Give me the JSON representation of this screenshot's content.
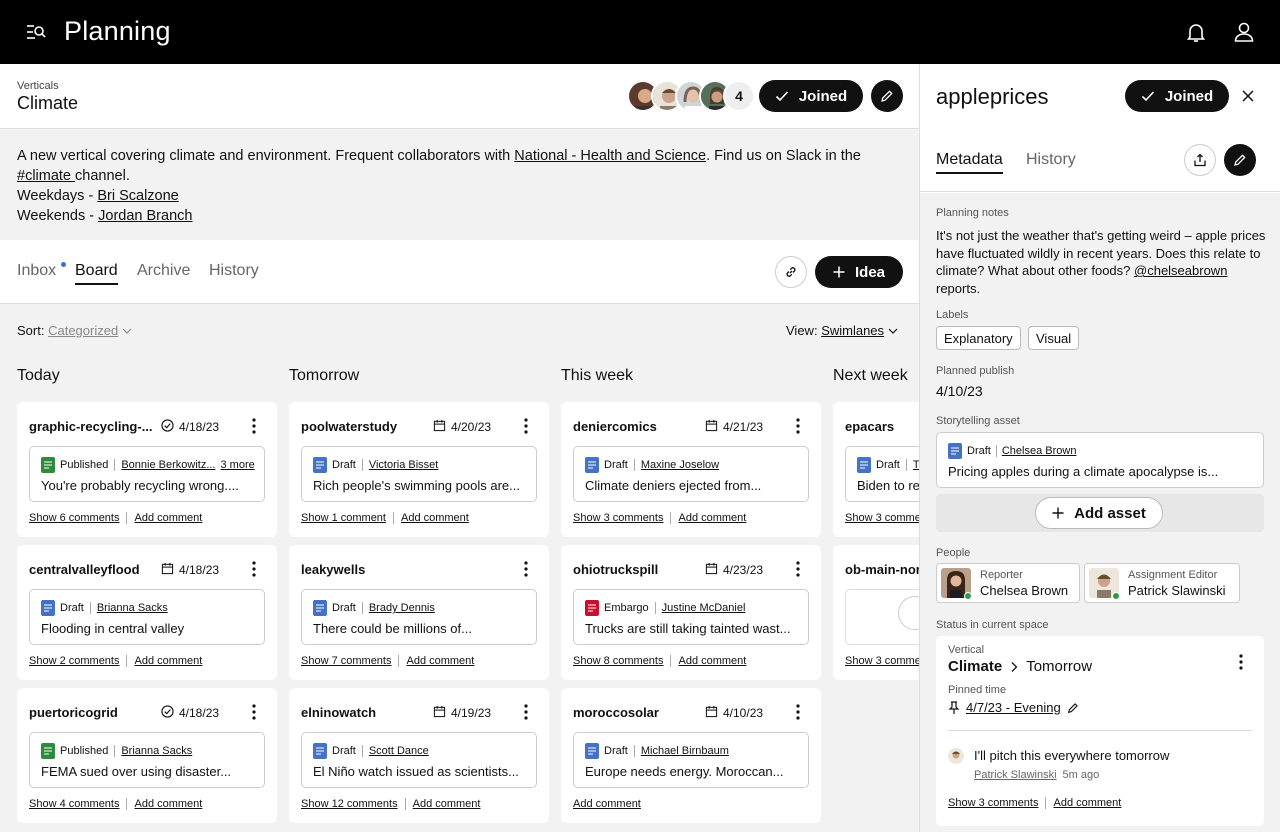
{
  "app": {
    "title": "Planning"
  },
  "vertical": {
    "kicker": "Verticals",
    "title": "Climate",
    "member_count": "4",
    "joined_label": "Joined",
    "desc_prefix": "A new vertical covering climate and environment. Frequent collaborators with ",
    "desc_link": "National - Health and Science",
    "desc_mid": ". Find us on Slack in the ",
    "desc_channel": "#climate ",
    "desc_suffix": "channel.",
    "weekdays_label": "Weekdays - ",
    "weekdays_name": "Bri Scalzone",
    "weekends_label": "Weekends - ",
    "weekends_name": "Jordan Branch"
  },
  "tabs": [
    "Inbox",
    "Board",
    "Archive",
    "History"
  ],
  "active_tab": "Board",
  "idea_label": "Idea",
  "sort": {
    "label": "Sort:",
    "value": "Categorized"
  },
  "view": {
    "label": "View:",
    "value": "Swimlanes"
  },
  "columns": [
    "Today",
    "Tomorrow",
    "This week",
    "Next week"
  ],
  "cards": [
    [
      {
        "slug": "graphic-recycling-...",
        "date": "4/18/23",
        "date_icon": "check-circle",
        "status": "Published",
        "author": "Bonnie Berkowitz...",
        "more": "3 more",
        "headline": "You're probably recycling wrong....",
        "comments": "Show 6 comments",
        "add": "Add comment"
      },
      {
        "slug": "centralvalleyflood",
        "date": "4/18/23",
        "date_icon": "calendar",
        "status": "Draft",
        "author": "Brianna Sacks",
        "headline": "Flooding in central valley",
        "comments": "Show 2 comments",
        "add": "Add comment"
      },
      {
        "slug": "puertoricogrid",
        "date": "4/18/23",
        "date_icon": "check-circle",
        "status": "Published",
        "author": "Brianna Sacks",
        "headline": "FEMA sued over using disaster...",
        "comments": "Show 4 comments",
        "add": "Add comment"
      }
    ],
    [
      {
        "slug": "poolwaterstudy",
        "date": "4/20/23",
        "date_icon": "calendar",
        "status": "Draft",
        "author": "Victoria Bisset",
        "headline": "Rich people's swimming pools are...",
        "comments": "Show 1 comment",
        "add": "Add comment"
      },
      {
        "slug": "leakywells",
        "date": "",
        "date_icon": "",
        "status": "Draft",
        "author": "Brady Dennis",
        "headline": "There could be millions of...",
        "comments": "Show 7 comments",
        "add": "Add comment"
      },
      {
        "slug": "elninowatch",
        "date": "4/19/23",
        "date_icon": "calendar",
        "status": "Draft",
        "author": "Scott Dance",
        "headline": "El Niño watch issued as scientists...",
        "comments": "Show 12 comments",
        "add": "Add comment"
      }
    ],
    [
      {
        "slug": "deniercomics",
        "date": "4/21/23",
        "date_icon": "calendar",
        "status": "Draft",
        "author": "Maxine Joselow",
        "headline": "Climate deniers ejected from...",
        "comments": "Show 3 comments",
        "add": "Add comment"
      },
      {
        "slug": "ohiotruckspill",
        "date": "4/23/23",
        "date_icon": "calendar",
        "status": "Embargo",
        "author": "Justine McDaniel",
        "headline": "Trucks are still taking tainted wast...",
        "comments": "Show 8 comments",
        "add": "Add comment"
      },
      {
        "slug": "moroccosolar",
        "date": "4/10/23",
        "date_icon": "calendar",
        "status": "Draft",
        "author": "Michael Birnbaum",
        "headline": "Europe needs energy. Moroccan...",
        "comments": "",
        "add": "Add comment"
      }
    ],
    [
      {
        "slug": "epacars",
        "status": "Draft",
        "author": "T",
        "headline": "Biden to re",
        "comments": "Show 3 comme"
      },
      {
        "slug": "ob-main-nor",
        "comments": "Show 3 comme"
      }
    ]
  ],
  "panel": {
    "title": "appleprices",
    "joined_label": "Joined",
    "tabs": [
      "Metadata",
      "History"
    ],
    "notes_label": "Planning notes",
    "notes_text": "It's not just the weather that's getting weird – apple prices have fluctuated wildly in recent years. Does this relate to climate? What about other foods? ",
    "notes_mention": "@chelseabrown",
    "notes_suffix": " reports.",
    "labels_label": "Labels",
    "labels": [
      "Explanatory",
      "Visual"
    ],
    "publish_label": "Planned publish",
    "publish_date": "4/10/23",
    "asset_label": "Storytelling asset",
    "asset_status": "Draft",
    "asset_author": "Chelsea Brown",
    "asset_headline": "Pricing apples during a climate apocalypse is...",
    "add_asset": "Add asset",
    "people_label": "People",
    "people": [
      {
        "role": "Reporter",
        "name": "Chelsea Brown"
      },
      {
        "role": "Assignment Editor",
        "name": "Patrick Slawinski"
      }
    ],
    "status_label": "Status in current space",
    "status_kicker": "Vertical",
    "status_space": "Climate",
    "status_value": "Tomorrow",
    "pinned_label": "Pinned time",
    "pinned_value": "4/7/23 - Evening",
    "comment_text": "I'll pitch this everywhere tomorrow",
    "comment_author": "Patrick Slawinski",
    "comment_time": "5m ago",
    "comments_link": "Show 3 comments",
    "add_comment": "Add comment"
  },
  "colors": {
    "published": "#2e8b3e",
    "draft": "#4472c4",
    "embargo": "#c8102e",
    "inbox_dot": "#3a6fd8"
  }
}
